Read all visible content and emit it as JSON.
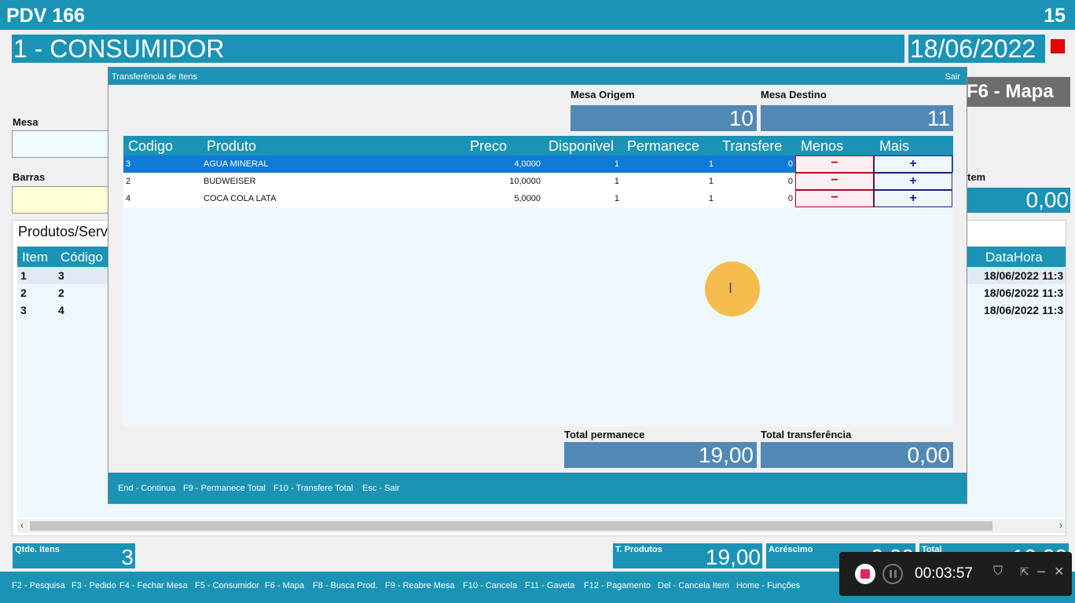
{
  "header": {
    "title": "PDV 166",
    "number": "15"
  },
  "client": {
    "name": "1 - CONSUMIDOR",
    "date": "18/06/2022",
    "map_button": "F6 - Mapa"
  },
  "form": {
    "mesa_label": "Mesa",
    "barras_label": "Barras",
    "item_label": "tem",
    "item_value": "0,00"
  },
  "background_list": {
    "title": "Produtos/Serv",
    "col_item": "Item",
    "col_codigo": "Código",
    "col_datahora": "DataHora",
    "rows": [
      {
        "item": "1",
        "codigo": "3",
        "datahora": "18/06/2022 11:3"
      },
      {
        "item": "2",
        "codigo": "2",
        "datahora": "18/06/2022 11:3"
      },
      {
        "item": "3",
        "codigo": "4",
        "datahora": "18/06/2022 11:3"
      }
    ]
  },
  "dialog": {
    "title": "Transferência de Itens",
    "close": "Sair",
    "origem_label": "Mesa Origem",
    "origem_value": "10",
    "destino_label": "Mesa Destino",
    "destino_value": "11",
    "columns": {
      "codigo": "Codigo",
      "produto": "Produto",
      "preco": "Preco",
      "disponivel": "Disponivel",
      "permanece": "Permanece",
      "transfere": "Transfere",
      "menos": "Menos",
      "mais": "Mais"
    },
    "rows": [
      {
        "codigo": "3",
        "produto": "AGUA MINERAL",
        "preco": "4,0000",
        "disponivel": "1",
        "permanece": "1",
        "transfere": "0",
        "menos": "−",
        "mais": "+"
      },
      {
        "codigo": "2",
        "produto": "BUDWEISER",
        "preco": "10,0000",
        "disponivel": "1",
        "permanece": "1",
        "transfere": "0",
        "menos": "−",
        "mais": "+"
      },
      {
        "codigo": "4",
        "produto": "COCA COLA LATA",
        "preco": "5,0000",
        "disponivel": "1",
        "permanece": "1",
        "transfere": "0",
        "menos": "−",
        "mais": "+"
      }
    ],
    "total_permanece_label": "Total permanece",
    "total_permanece_value": "19,00",
    "total_transferencia_label": "Total transferência",
    "total_transferencia_value": "0,00",
    "footer": {
      "end": "End - Continua",
      "f9": "F9 - Permanece Total",
      "f10": "F10 - Transfere Total",
      "esc": "Esc - Sair"
    }
  },
  "totals": {
    "qtde_label": "Qtde. Itens",
    "qtde_value": "3",
    "tprod_label": "T. Produtos",
    "tprod_value": "19,00",
    "acresc_label": "Acréscimo",
    "acresc_value": "0,00",
    "total_label": "Total",
    "total_value": "19,00"
  },
  "fkeys": {
    "f2": "F2 - Pesquisa",
    "f3": "F3 - Pedido",
    "f4": "F4 - Fechar Mesa",
    "f5": "F5 - Consumidor",
    "f6": "F6 - Mapa",
    "f8": "F8 - Busca Prod.",
    "f9": "F9 - Reabre Mesa",
    "f10": "F10 - Cancela",
    "f11": "F11 - Gaveta",
    "f12": "F12 - Pagamento",
    "del": "Del - Cancela Item",
    "home": "Home - Funções"
  },
  "recorder": {
    "time": "00:03:57"
  },
  "colors": {
    "accent": "#1a93b5",
    "value_box": "#5188b4",
    "selected_row": "#0e7ad6",
    "cursor_highlight": "#f5b944"
  }
}
